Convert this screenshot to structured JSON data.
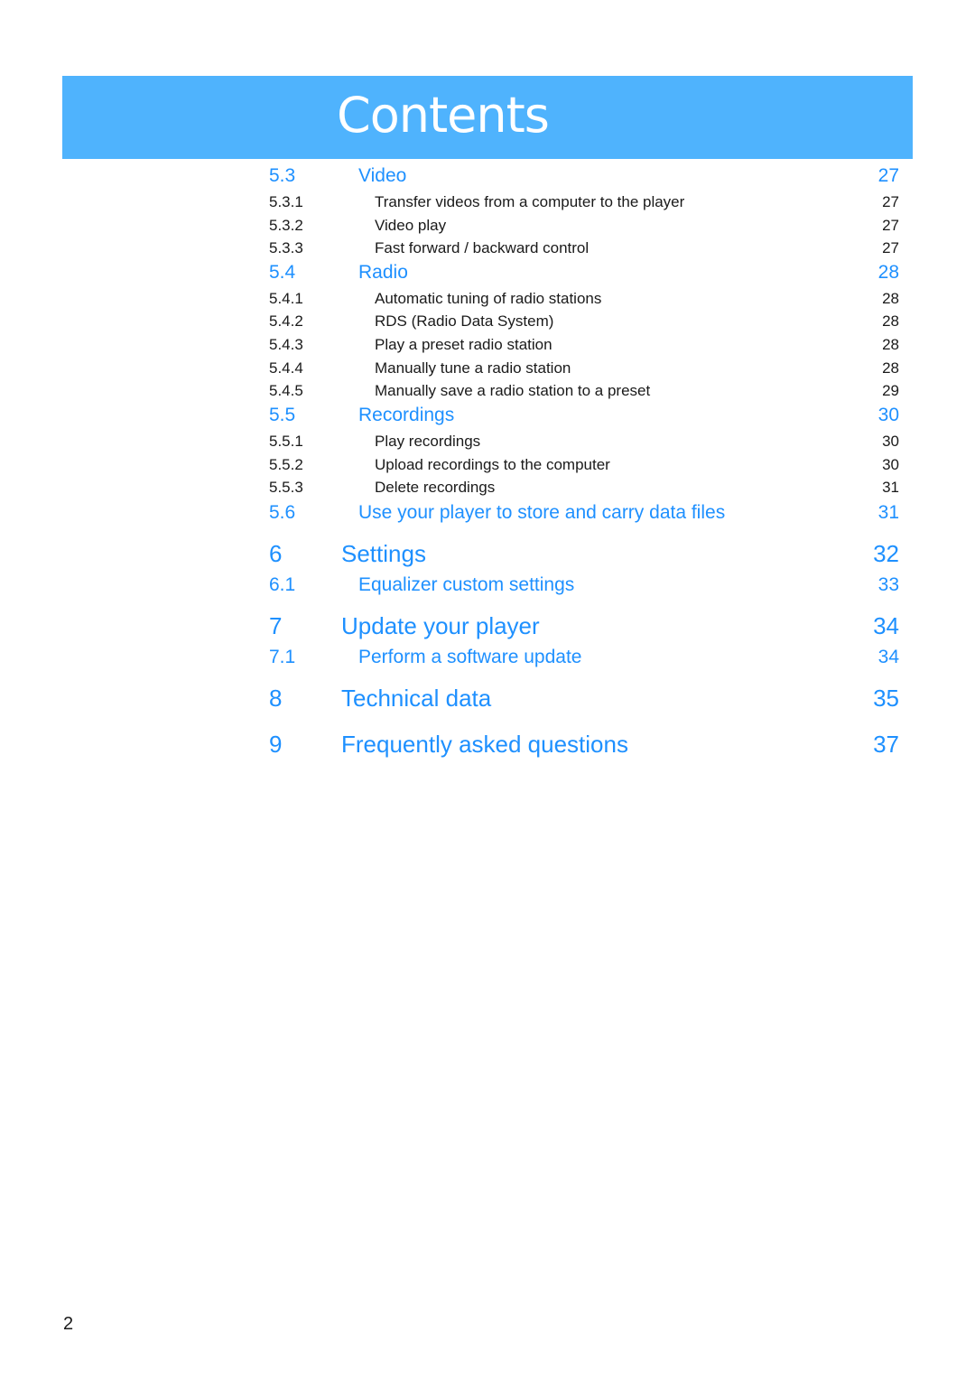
{
  "header": {
    "title": "Contents",
    "banner_color": "#4fb3fd",
    "accent_color": "#1e90ff"
  },
  "toc": [
    {
      "level": 2,
      "num": "5.3",
      "title": "Video",
      "page": "27"
    },
    {
      "level": 3,
      "num": "5.3.1",
      "title": "Transfer videos from a computer to the player",
      "page": "27"
    },
    {
      "level": 3,
      "num": "5.3.2",
      "title": "Video play",
      "page": "27"
    },
    {
      "level": 3,
      "num": "5.3.3",
      "title": "Fast forward / backward control",
      "page": "27"
    },
    {
      "level": 2,
      "num": "5.4",
      "title": "Radio",
      "page": "28"
    },
    {
      "level": 3,
      "num": "5.4.1",
      "title": "Automatic tuning of radio stations",
      "page": "28"
    },
    {
      "level": 3,
      "num": "5.4.2",
      "title": "RDS (Radio Data System)",
      "page": "28"
    },
    {
      "level": 3,
      "num": "5.4.3",
      "title": "Play a preset radio station",
      "page": "28"
    },
    {
      "level": 3,
      "num": "5.4.4",
      "title": "Manually tune a radio station",
      "page": "28"
    },
    {
      "level": 3,
      "num": "5.4.5",
      "title": "Manually save a radio station to a preset",
      "page": "29"
    },
    {
      "level": 2,
      "num": "5.5",
      "title": "Recordings",
      "page": "30"
    },
    {
      "level": 3,
      "num": "5.5.1",
      "title": "Play recordings",
      "page": "30"
    },
    {
      "level": 3,
      "num": "5.5.2",
      "title": "Upload recordings to the computer",
      "page": "30"
    },
    {
      "level": 3,
      "num": "5.5.3",
      "title": "Delete recordings",
      "page": "31"
    },
    {
      "level": 2,
      "num": "5.6",
      "title": "Use your player to store and carry data files",
      "page": "31"
    },
    {
      "level": 1,
      "num": "6",
      "title": "Settings",
      "page": "32"
    },
    {
      "level": 2,
      "num": "6.1",
      "title": "Equalizer custom settings",
      "page": "33"
    },
    {
      "level": 1,
      "num": "7",
      "title": "Update your player",
      "page": "34"
    },
    {
      "level": 2,
      "num": "7.1",
      "title": "Perform a software update",
      "page": "34"
    },
    {
      "level": 1,
      "num": "8",
      "title": "Technical data",
      "page": "35"
    },
    {
      "level": 1,
      "num": "9",
      "title": "Frequently asked questions",
      "page": "37"
    }
  ],
  "footer": {
    "page_number": "2"
  }
}
